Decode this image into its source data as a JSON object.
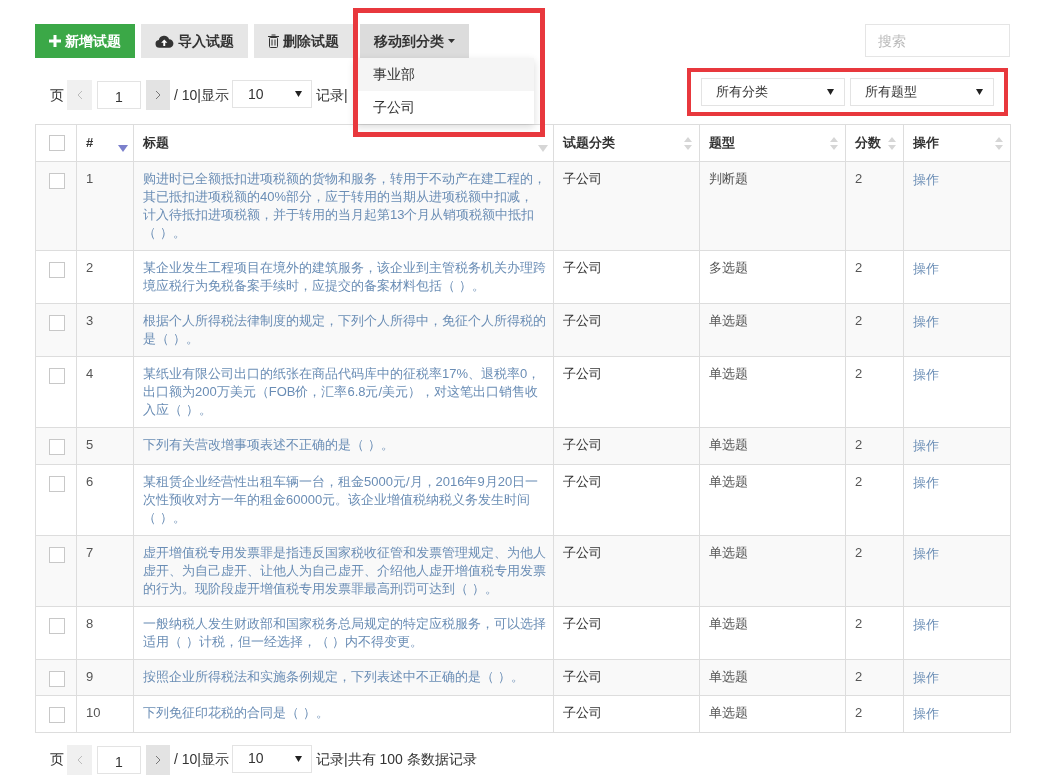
{
  "toolbar": {
    "buttons": [
      {
        "kind": "add",
        "label": "新增试题"
      },
      {
        "kind": "import",
        "label": "导入试题"
      },
      {
        "kind": "delete",
        "label": "删除试题"
      },
      {
        "kind": "move",
        "label": "移动到分类",
        "expanded": true,
        "highlighted": true,
        "menu": [
          {
            "label": "事业部",
            "selected": true
          },
          {
            "label": "子公司",
            "selected": false
          }
        ]
      }
    ],
    "search": {
      "placeholder": "搜索"
    }
  },
  "pagination_top": {
    "page_label": "页",
    "prev": {
      "disabled": true
    },
    "page": "1",
    "next": {
      "disabled": false
    },
    "page_count": "/ 10|显示",
    "page_size": "10",
    "summary": "记录|"
  },
  "filters": {
    "highlighted": true,
    "selects": [
      {
        "value": "所有分类"
      },
      {
        "value": "所有题型"
      }
    ]
  },
  "table": {
    "select_all": {
      "checked": false
    },
    "columns": [
      {
        "label": "#",
        "kind": "single",
        "sorted": true
      },
      {
        "label": "标题",
        "kind": "single",
        "sorted": false
      },
      {
        "label": "试题分类",
        "kind": "double",
        "sorted": false
      },
      {
        "label": "题型",
        "kind": "double",
        "sorted": false
      },
      {
        "label": "分数",
        "kind": "double",
        "sorted": false
      },
      {
        "label": "操作",
        "kind": "double",
        "sorted": false
      }
    ],
    "rows": [
      {
        "checked": false,
        "number": "1",
        "title": "购进时已全额抵扣进项税额的货物和服务，转用于不动产在建工程的，其已抵扣进项税额的40%部分，应于转用的当期从进项税额中扣减，计入待抵扣进项税额，并于转用的当月起第13个月从销项税额中抵扣（ ）。",
        "category": "子公司",
        "type": "判断题",
        "score": "2",
        "action": "操作"
      },
      {
        "checked": false,
        "number": "2",
        "title": "某企业发生工程项目在境外的建筑服务，该企业到主管税务机关办理跨境应税行为免税备案手续时，应提交的备案材料包括（ ）。",
        "category": "子公司",
        "type": "多选题",
        "score": "2",
        "action": "操作"
      },
      {
        "checked": false,
        "number": "3",
        "title": "根据个人所得税法律制度的规定，下列个人所得中，免征个人所得税的是（ ）。",
        "category": "子公司",
        "type": "单选题",
        "score": "2",
        "action": "操作"
      },
      {
        "checked": false,
        "number": "4",
        "title": "某纸业有限公司出口的纸张在商品代码库中的征税率17%、退税率0，出口额为200万美元（FOB价，汇率6.8元/美元），对这笔出口销售收入应（ ）。",
        "category": "子公司",
        "type": "单选题",
        "score": "2",
        "action": "操作"
      },
      {
        "checked": false,
        "number": "5",
        "title": "下列有关营改增事项表述不正确的是（ ）。",
        "category": "子公司",
        "type": "单选题",
        "score": "2",
        "action": "操作"
      },
      {
        "checked": false,
        "number": "6",
        "title": "某租赁企业经营性出租车辆一台，租金5000元/月，2016年9月20日一次性预收对方一年的租金60000元。该企业增值税纳税义务发生时间（ ）。",
        "category": "子公司",
        "type": "单选题",
        "score": "2",
        "action": "操作"
      },
      {
        "checked": false,
        "number": "7",
        "title": "虚开增值税专用发票罪是指违反国家税收征管和发票管理规定、为他人虚开、为自己虚开、让他人为自己虚开、介绍他人虚开增值税专用发票的行为。现阶段虚开增值税专用发票罪最高刑罚可达到（ ）。",
        "category": "子公司",
        "type": "单选题",
        "score": "2",
        "action": "操作"
      },
      {
        "checked": false,
        "number": "8",
        "title": "一般纳税人发生财政部和国家税务总局规定的特定应税服务，可以选择适用（ ）计税，但一经选择，（ ）内不得变更。",
        "category": "子公司",
        "type": "单选题",
        "score": "2",
        "action": "操作"
      },
      {
        "checked": false,
        "number": "9",
        "title": "按照企业所得税法和实施条例规定，下列表述中不正确的是（ ）。",
        "category": "子公司",
        "type": "单选题",
        "score": "2",
        "action": "操作"
      },
      {
        "checked": false,
        "number": "10",
        "title": "下列免征印花税的合同是（ ）。",
        "category": "子公司",
        "type": "单选题",
        "score": "2",
        "action": "操作"
      }
    ]
  },
  "pagination_bottom": {
    "page_label": "页",
    "prev": {
      "disabled": true
    },
    "page": "1",
    "next": {
      "disabled": false
    },
    "page_count": "/ 10|显示",
    "page_size": "10",
    "summary": "记录|共有 100 条数据记录"
  }
}
